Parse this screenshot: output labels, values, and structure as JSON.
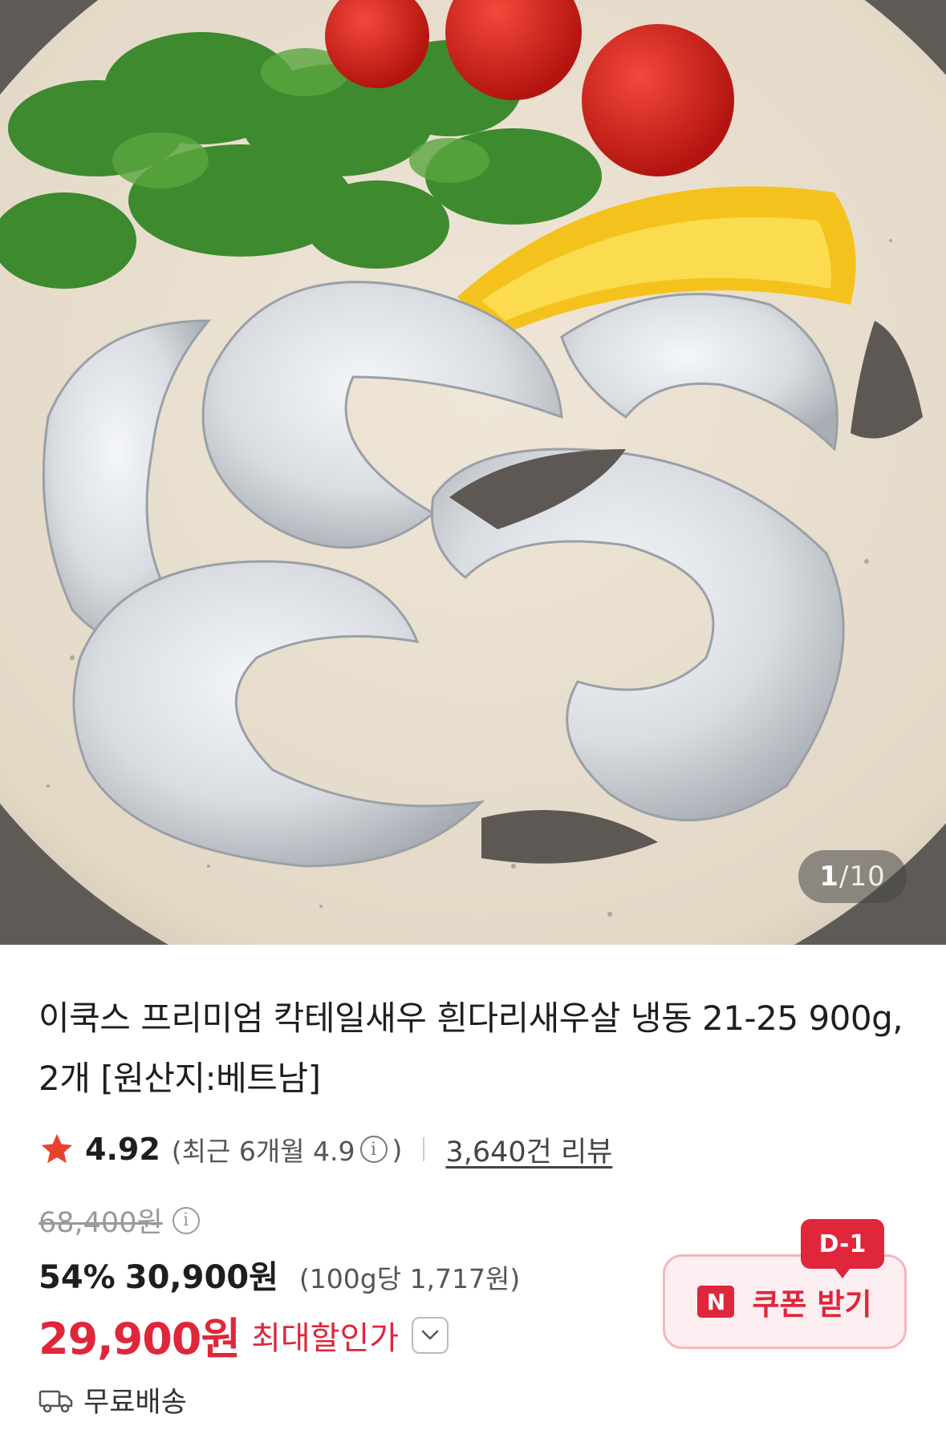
{
  "gallery": {
    "current": "1",
    "separator": "/",
    "total": "10"
  },
  "product": {
    "title": "이쿡스 프리미엄 칵테일새우 흰다리새우살 냉동 21-25 900g, 2개 [원산지:베트남]",
    "rating": "4.92",
    "recent_rating": "(최근 6개월 4.9",
    "recent_close": ")",
    "review_count": "3,640건 리뷰"
  },
  "pricing": {
    "original_price": "68,400원",
    "discount_rate": "54%",
    "sale_price": "30,900원",
    "unit_price": "(100g당 1,717원)",
    "max_discount_price": "29,900원",
    "max_discount_label": "최대할인가"
  },
  "coupon": {
    "badge": "D-1",
    "logo": "N",
    "label": "쿠폰 받기"
  },
  "shipping": {
    "label": "무료배송"
  },
  "colors": {
    "accent_red": "#e0263a",
    "coupon_bg": "#fdeff1",
    "coupon_border": "#f3b7bf",
    "star": "#e8412c"
  }
}
